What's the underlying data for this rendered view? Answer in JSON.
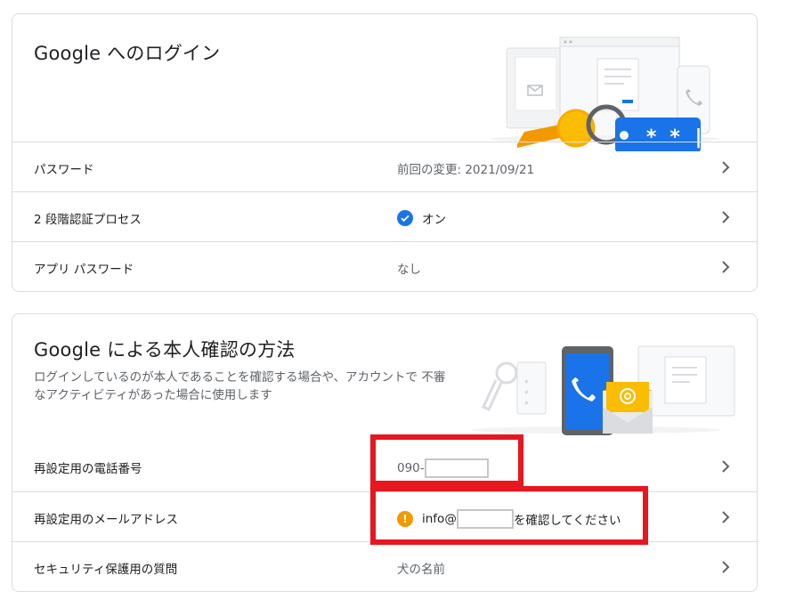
{
  "signin_card": {
    "title": "Google へのログイン",
    "rows": [
      {
        "label": "パスワード",
        "value": "前回の変更: 2021/09/21"
      },
      {
        "label": "2 段階認証プロセス",
        "value": "オン"
      },
      {
        "label": "アプリ パスワード",
        "value": "なし"
      }
    ],
    "illustration_text": "* * |"
  },
  "verify_card": {
    "title": "Google による本人確認の方法",
    "description": "ログインしているのが本人であることを確認する場合や、アカウントで 不審なアクティビティがあった場合に使用します",
    "rows": [
      {
        "label": "再設定用の電話番号",
        "value_prefix": "090-"
      },
      {
        "label": "再設定用のメールアドレス",
        "value_prefix": "info@",
        "value_suffix": "を確認してください"
      },
      {
        "label": "セキュリティ保護用の質問",
        "value": "犬の名前"
      }
    ]
  },
  "icons": {
    "chevron": "chevron-right-icon",
    "check": "check-circle-icon",
    "warning": "warning-circle-icon"
  },
  "colors": {
    "accent": "#1a73e8",
    "warning": "#f29900",
    "highlight": "#e8161e",
    "key": "#fbbc04"
  }
}
